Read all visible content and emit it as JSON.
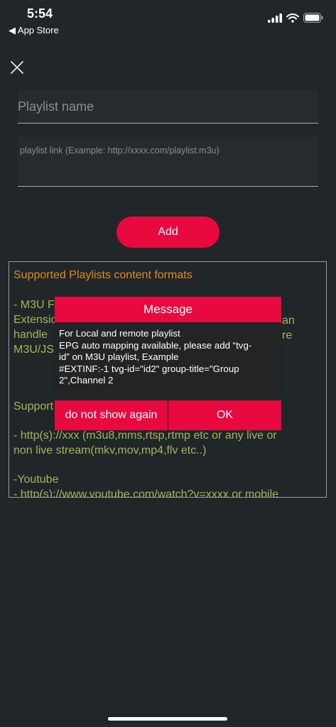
{
  "status_bar": {
    "time": "5:54",
    "back_label": "◀ App Store"
  },
  "form": {
    "name_placeholder": "Playlist name",
    "link_placeholder": "playlist link (Example: http://xxxx.com/playlist.m3u)",
    "add_label": "Add"
  },
  "info": {
    "lines": [
      "Supported Playlists content formats",
      "- M3U F",
      "Extensio",
      "handle",
      "M3U/JS",
      "Support",
      "- http(s)://xxx (m3u8,mms,rtsp,rtmp etc or any live or",
      "non live stream(mkv,mov,mp4,flv etc..)",
      "-Youtube",
      "- http(s)://www.youtube.com/watch?v=xxxx or mobile"
    ],
    "right_fragments": [
      "an",
      "re"
    ]
  },
  "dialog": {
    "title": "Message",
    "body": [
      "For Local and remote playlist",
      "EPG auto mapping available, please add “tvg-",
      "id” on M3U playlist, Example",
      "#EXTINF:-1 tvg-id=\"id2\" group-title=\"Group",
      "2\",Channel 2"
    ],
    "dont_show_label": "do not show again",
    "ok_label": "OK"
  },
  "colors": {
    "background": "#212629",
    "accent": "#e8093f",
    "heading_text": "#e08a1c",
    "body_text": "#a8b35a"
  }
}
